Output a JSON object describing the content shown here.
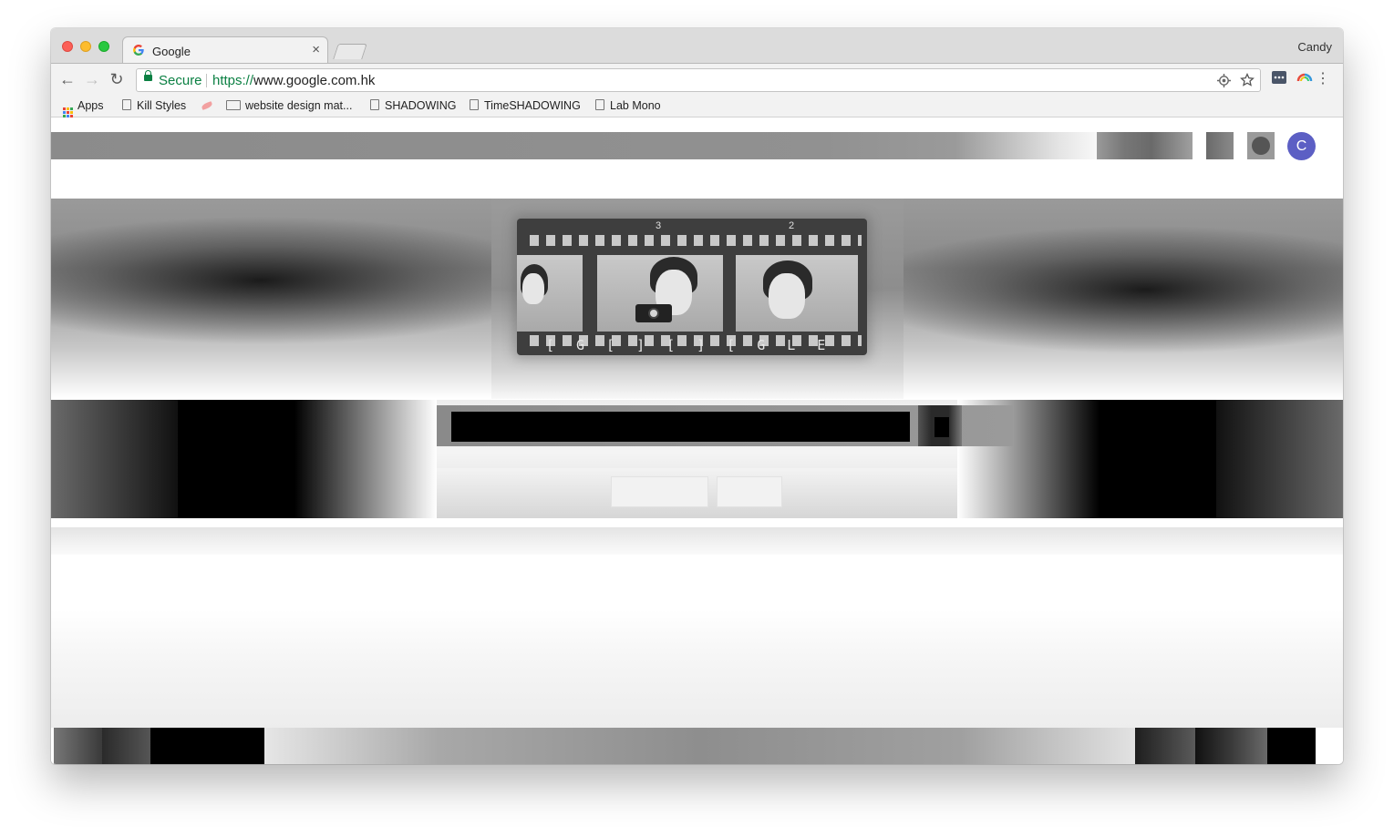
{
  "browser": {
    "tab": {
      "title": "Google",
      "close_glyph": "×"
    },
    "profile_name": "Candy",
    "nav": {
      "back_glyph": "←",
      "forward_glyph": "→",
      "reload_glyph": "↻"
    },
    "omnibox": {
      "security_label": "Secure",
      "url_scheme": "https://",
      "url_rest": "www.google.com.hk"
    },
    "bookmarks": [
      {
        "label": "Apps",
        "icon": "apps-grid-icon"
      },
      {
        "label": "Kill Styles",
        "icon": "page-icon"
      },
      {
        "label": "website design mat...",
        "icon": "folder-icon"
      },
      {
        "label": "SHADOWING",
        "icon": "page-icon"
      },
      {
        "label": "TimeSHADOWING",
        "icon": "page-icon"
      },
      {
        "label": "Lab Mono",
        "icon": "page-icon"
      }
    ]
  },
  "page": {
    "avatar_letter": "C",
    "doodle": {
      "frame_numbers": [
        "3",
        "2"
      ],
      "letters": "[G[][][GLE"
    },
    "search": {
      "input_value": "",
      "search_button": "",
      "lucky_button": ""
    }
  },
  "colors": {
    "secure_green": "#0b8043",
    "avatar_purple": "#5c5fc4"
  }
}
